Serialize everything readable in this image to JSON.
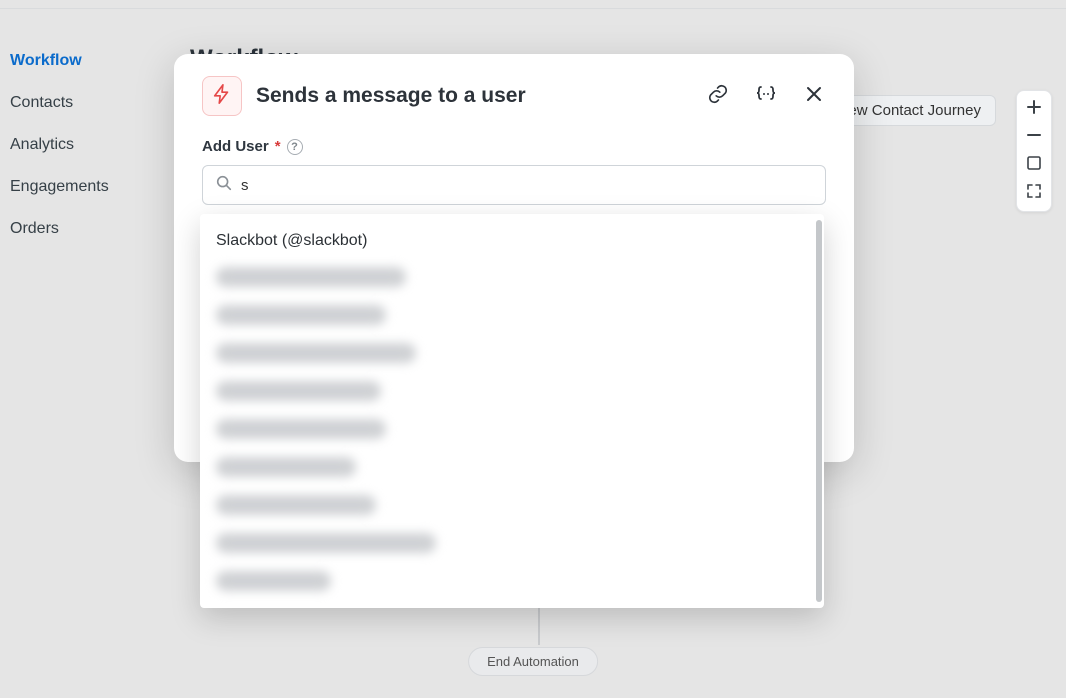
{
  "sidebar": {
    "items": [
      {
        "label": "Workflow",
        "active": true
      },
      {
        "label": "Contacts",
        "active": false
      },
      {
        "label": "Analytics",
        "active": false
      },
      {
        "label": "Engagements",
        "active": false
      },
      {
        "label": "Orders",
        "active": false
      }
    ]
  },
  "page": {
    "title": "Workflow"
  },
  "canvas": {
    "preview_button": "iew Contact Journey",
    "end_pill": "End Automation"
  },
  "modal": {
    "title": "Sends a message to a user",
    "field_label": "Add User",
    "required_marker": "*",
    "help_glyph": "?",
    "search_value": "s",
    "search_placeholder": ""
  },
  "dropdown": {
    "visible_item": "Slackbot (@slackbot)",
    "blurred_widths": [
      190,
      170,
      200,
      165,
      170,
      140,
      160,
      220,
      115
    ]
  },
  "header_icons": {
    "link": "link-icon",
    "vars": "variables-icon",
    "close": "close-icon"
  }
}
